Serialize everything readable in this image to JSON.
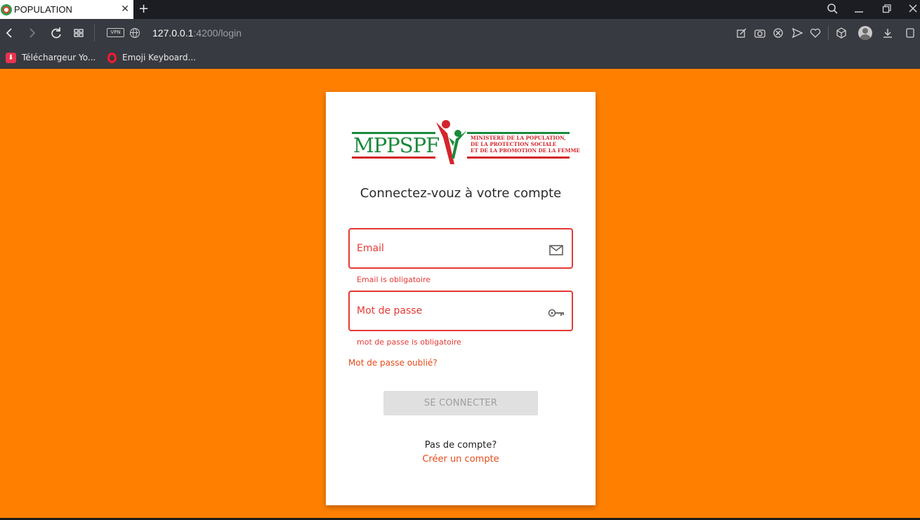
{
  "browser": {
    "tab_title": "POPULATION",
    "tab_close": "✕",
    "new_tab": "+",
    "url_host": "127.0.0.1",
    "url_rest": ":4200/login",
    "vpn_label": "VPN",
    "bookmarks": [
      {
        "label": "Téléchargeur Yo..."
      },
      {
        "label": "Emoji Keyboard..."
      }
    ]
  },
  "logo": {
    "title": "MPPSPF",
    "subtitle_lines": [
      "MINISTERE DE LA POPULATION,",
      "DE LA PROTECTION SOCIALE",
      "ET DE LA PROMOTION DE LA FEMME"
    ]
  },
  "login": {
    "heading": "Connectez-vouz à votre compte",
    "email_label": "Email",
    "email_error": "Email is obligatoire",
    "password_label": "Mot de passe",
    "password_error": "mot de passe is obligatoire",
    "forgot_password": "Mot de passe oublié?",
    "submit_label": "SE CONNECTER",
    "no_account": "Pas de compte?",
    "create_account": "Créer un compte"
  },
  "colors": {
    "page_background": "#ff8000",
    "error": "#e53935",
    "link": "#e64a19",
    "logo_green": "#1a8a3c",
    "logo_red": "#d3262c"
  }
}
